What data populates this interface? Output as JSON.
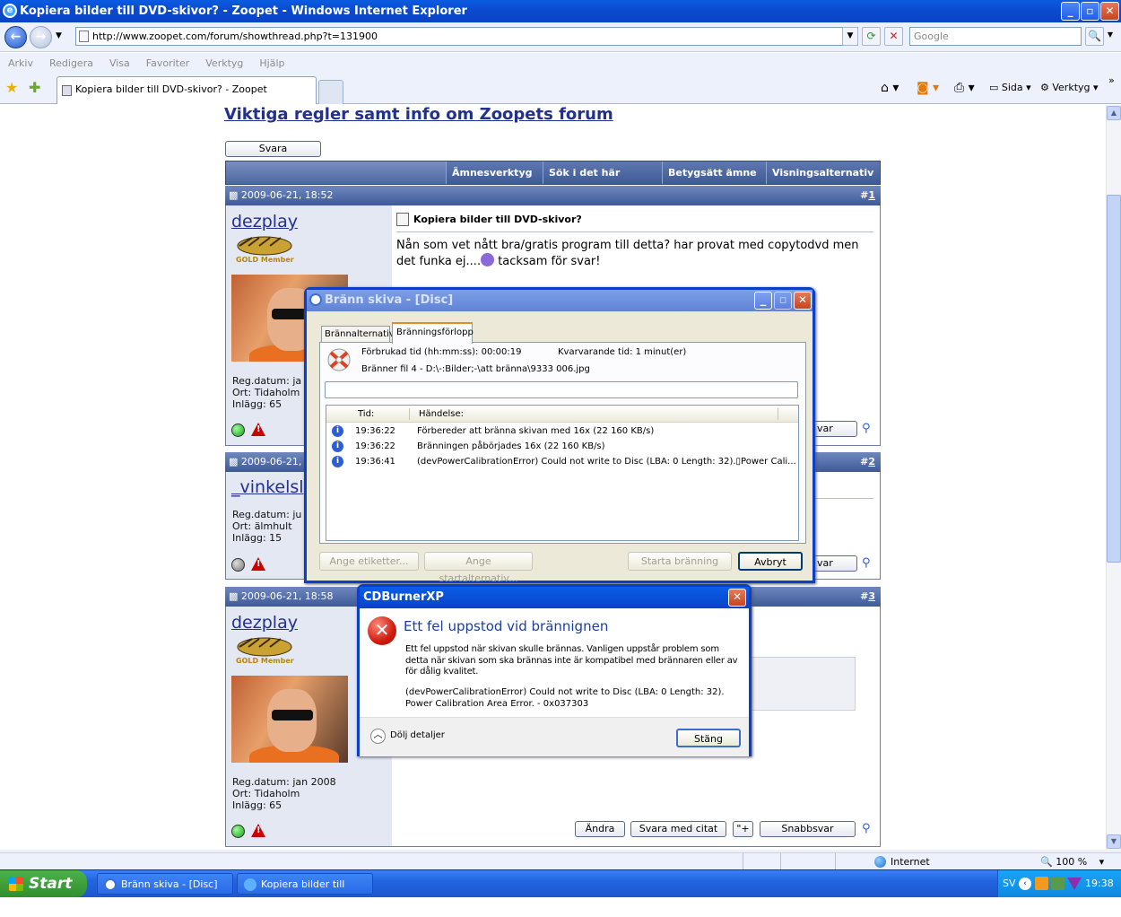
{
  "browser": {
    "title": "Kopiera bilder till DVD-skivor? - Zoopet - Windows Internet Explorer",
    "url": "http://www.zoopet.com/forum/showthread.php?t=131900",
    "search_placeholder": "Google",
    "menu": [
      "Arkiv",
      "Redigera",
      "Visa",
      "Favoriter",
      "Verktyg",
      "Hjälp"
    ],
    "tab_label": "Kopiera bilder till DVD-skivor? - Zoopet",
    "tools": {
      "sida": "Sida",
      "verktyg": "Verktyg"
    },
    "status_zone": "Internet",
    "zoom": "100 %"
  },
  "forum": {
    "rules_link": "Viktiga regler samt info om Zoopets forum",
    "reply_button": "Svara",
    "thread_menus": [
      "Ämnesverktyg",
      "Sök i det här ämnet",
      "Betygsätt ämne",
      "Visningsalternativ"
    ],
    "posts": [
      {
        "date": "2009-06-21, 18:52",
        "number": "1",
        "user": "dezplay",
        "badge": "GOLD Member",
        "reg": "Reg.datum: ja",
        "ort": "Ort: Tidaholm",
        "inlagg": "Inlägg: 65",
        "title": "Kopiera bilder till DVD-skivor?",
        "text": "Nån som vet nått bra/gratis program till detta? har provat med copytodvd men det funka ej....",
        "text_end": " tacksam för svar!",
        "button_partial": "var"
      },
      {
        "date": "2009-06-21, 18",
        "number": "2",
        "user": "_vinkelsl",
        "reg": "Reg.datum: ju",
        "ort": "Ort: älmhult",
        "inlagg": "Inlägg: 15",
        "button_partial": "var"
      },
      {
        "date": "2009-06-21, 18:58",
        "number": "3",
        "user": "dezplay",
        "badge": "GOLD Member",
        "reg": "Reg.datum: jan 2008",
        "ort": "Ort: Tidaholm",
        "inlagg": "Inlägg: 65",
        "buttons": {
          "edit": "Ändra",
          "quote": "Svara med citat",
          "multi": "\"+",
          "quick": "Snabbsvar"
        }
      }
    ]
  },
  "burn_dialog": {
    "title": "Bränn skiva - [Disc]",
    "tabs": [
      "Brännalternativ",
      "Bränningsförlopp"
    ],
    "elapsed": "Förbrukad tid (hh:mm:ss): 00:00:19",
    "remaining": "Kvarvarande tid: 1 minut(er)",
    "file": "Bränner fil 4 - D:\\-:Bilder;-\\att bränna\\9333 006.jpg",
    "columns": [
      "Tid:",
      "Händelse:"
    ],
    "log": [
      {
        "time": "19:36:22",
        "event": "Förbereder att bränna skivan med 16x (22 160 KB/s)"
      },
      {
        "time": "19:36:22",
        "event": "Bränningen påbörjades 16x (22 160 KB/s)"
      },
      {
        "time": "19:36:41",
        "event": "(devPowerCalibrationError)  Could not write to Disc (LBA: 0 Length: 32).▯Power Cali..."
      }
    ],
    "buttons": {
      "labels": "Ange etiketter...",
      "start_opts": "Ange startalternativ...",
      "start": "Starta bränning",
      "cancel": "Avbryt"
    }
  },
  "error_dialog": {
    "title": "CDBurnerXP",
    "heading": "Ett fel uppstod vid brännignen",
    "message": "Ett fel uppstod när skivan skulle brännas. Vanligen uppstår problem som detta när skivan som ska brännas inte är kompatibel med brännaren eller av för dålig kvalitet.",
    "details_1": "(devPowerCalibrationError)   Could not write to Disc (LBA: 0 Length: 32).",
    "details_2": "Power Calibration Area Error. - 0x037303",
    "toggle": "Dölj detaljer",
    "close": "Stäng"
  },
  "taskbar": {
    "start": "Start",
    "tasks": [
      "Bränn skiva - [Disc]",
      "Kopiera bilder till DVD..."
    ],
    "lang": "SV",
    "clock": "19:38"
  }
}
